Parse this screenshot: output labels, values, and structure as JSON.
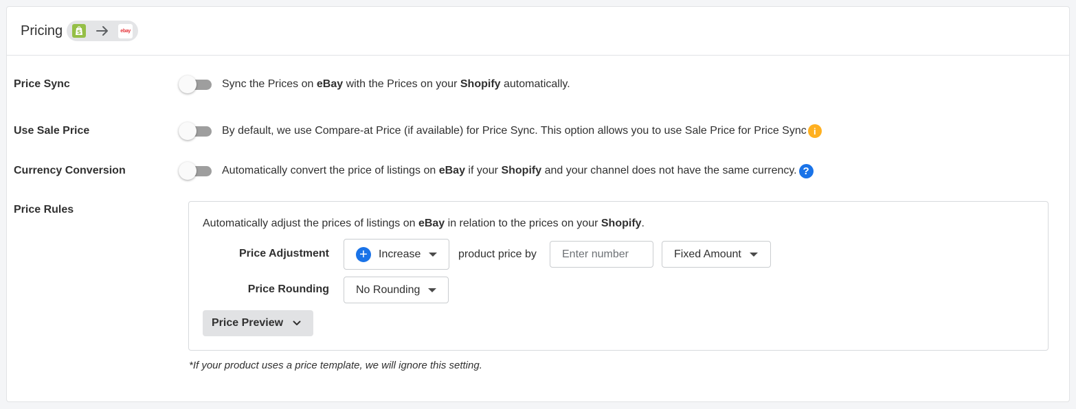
{
  "card": {
    "title": "Pricing",
    "flow": {
      "from_icon": "shopify-logo-icon",
      "arrow_icon": "arrow-right-icon",
      "to_icon": "ebay-logo-icon",
      "ebay_text": "ebay"
    }
  },
  "settings": {
    "price_sync": {
      "label": "Price Sync",
      "enabled": false,
      "desc": [
        "Sync the Prices on ",
        "eBay",
        " with the Prices on your ",
        "Shopify",
        " automatically."
      ]
    },
    "sale_price": {
      "label": "Use Sale Price",
      "enabled": false,
      "desc": "By default, we use Compare-at Price (if available) for Price Sync. This option allows you to use Sale Price for Price Sync",
      "info_glyph": "i"
    },
    "currency": {
      "label": "Currency Conversion",
      "enabled": false,
      "desc": [
        "Automatically convert the price of listings on ",
        "eBay",
        " if your ",
        "Shopify",
        " and your channel does not have the same currency."
      ],
      "help_glyph": "?"
    }
  },
  "rules": {
    "label": "Price Rules",
    "intro": [
      "Automatically adjust the prices of listings on ",
      "eBay",
      " in relation to the prices on your ",
      "Shopify",
      "."
    ],
    "adjustment": {
      "label": "Price Adjustment",
      "direction": "Increase",
      "connector": "product price by",
      "amount_placeholder": "Enter number",
      "amount_value": "",
      "type": "Fixed Amount"
    },
    "rounding": {
      "label": "Price Rounding",
      "value": "No Rounding"
    },
    "preview_label": "Price Preview",
    "footnote": "*If your product uses a price template, we will ignore this setting."
  },
  "colors": {
    "accent": "#1a73e8",
    "warning": "#ffb020",
    "shopify": "#95bf47"
  }
}
